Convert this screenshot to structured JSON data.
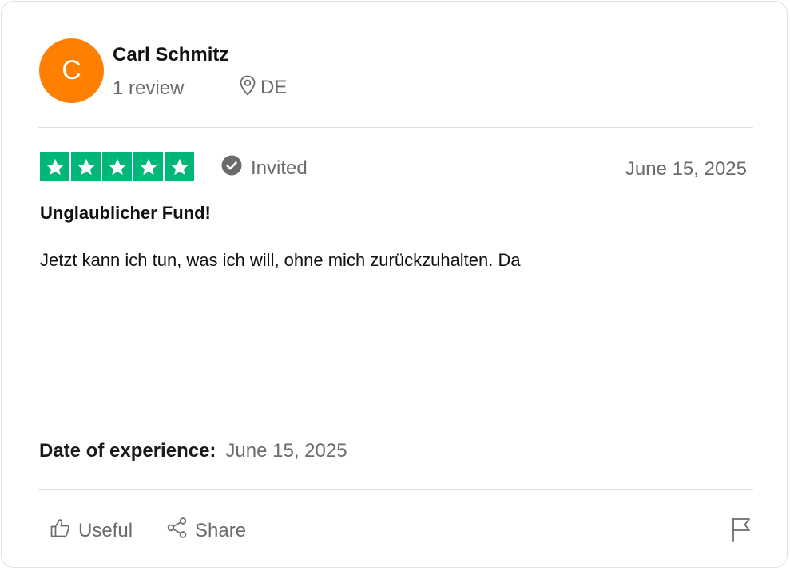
{
  "reviewer": {
    "initial": "C",
    "name": "Carl Schmitz",
    "review_count": "1 review",
    "country": "DE",
    "avatar_color": "#ff7f00"
  },
  "review": {
    "rating": 5,
    "rating_max": 5,
    "star_color": "#00b67a",
    "badge": "Invited",
    "badge_icon": "check-circle-icon",
    "date": "June 15, 2025",
    "title": "Unglaublicher Fund!",
    "body": "Jetzt kann ich tun, was ich will, ohne mich zurückzuhalten. Da"
  },
  "experience": {
    "label": "Date of experience:",
    "value": "June 15, 2025"
  },
  "actions": {
    "useful_label": "Useful",
    "useful_icon": "thumbs-up-icon",
    "share_label": "Share",
    "share_icon": "share-icon",
    "report_icon": "flag-icon"
  }
}
